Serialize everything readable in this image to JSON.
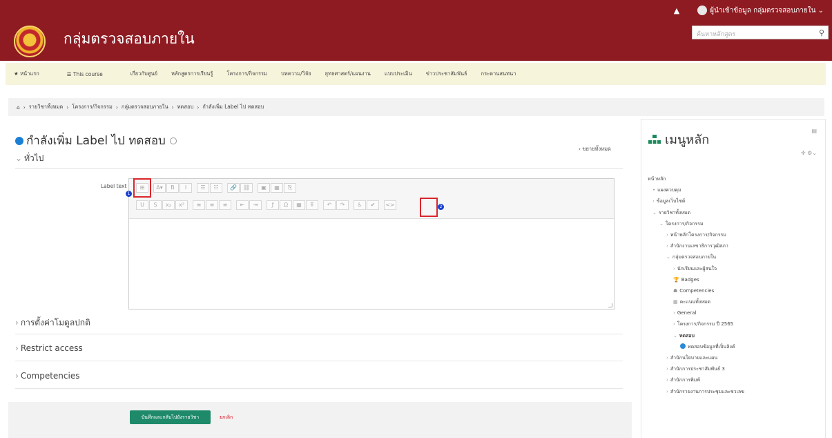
{
  "topbar": {
    "user_name": "ผู้นำเข้าข้อมูล กลุ่มตรวจสอบภายใน"
  },
  "header": {
    "site_name": "กลุ่มตรวจสอบภายใน",
    "search_placeholder": "ค้นหาหลักสูตร"
  },
  "nav": {
    "home": "หน้าแรก",
    "this_course": "This course",
    "items": [
      "เกี่ยวกับศูนย์",
      "หลักสูตรการเรียนรู้",
      "โครงการ/กิจกรรม",
      "บทความ/วิจัย",
      "ยุทธศาสตร์/แผนงาน",
      "แบบประเมิน",
      "ข่าวประชาสัมพันธ์",
      "กระดานสนทนา"
    ]
  },
  "breadcrumb": [
    "รายวิชาทั้งหมด",
    "โครงการ/กิจกรรม",
    "กลุ่มตรวจสอบภายใน",
    "ทดสอบ",
    "กำลังเพิ่ม Label ไป ทดสอบ"
  ],
  "page": {
    "title": "กำลังเพิ่ม Label ไป ทดสอบ",
    "expand_all": "ขยายทั้งหมด",
    "section_general": "ทั่วไป",
    "label_text": "Label text",
    "section_default": "การตั้งค่าโมดูลปกติ",
    "section_restrict": "Restrict access",
    "section_competencies": "Competencies",
    "save_button": "บันทึกและกลับไปยังรายวิชา",
    "cancel_button": "ยกเลิก",
    "markers": [
      "1",
      "2"
    ]
  },
  "editor_toolbar": {
    "row1": [
      "⊞",
      "A▾",
      "B",
      "I",
      "☰",
      "☷",
      "🔗",
      "⛓",
      "▣",
      "▦",
      "⎘"
    ],
    "row2": [
      "U",
      "S",
      "x₂",
      "x²",
      "≡",
      "≡",
      "≡",
      "⇤",
      "⇥",
      "ƒ",
      "Ω",
      "▦",
      "T̶",
      "↶",
      "↷",
      "♿",
      "✔",
      "<>"
    ]
  },
  "sidebar": {
    "title": "เมนูหลัก",
    "items": [
      {
        "label": "หน้าหลัก",
        "level": 0,
        "marker": ""
      },
      {
        "label": "แผงควบคุม",
        "level": 1,
        "marker": "•"
      },
      {
        "label": "ข้อมูลเว็บไซต์",
        "level": 1,
        "marker": "›"
      },
      {
        "label": "รายวิชาทั้งหมด",
        "level": 1,
        "marker": "⌄"
      },
      {
        "label": "โครงการ/กิจกรรม",
        "level": 2,
        "marker": "⌄"
      },
      {
        "label": "หน้าหลักโครงการ/กิจกรรม",
        "level": 3,
        "marker": "›"
      },
      {
        "label": "สำนักงานเลขาธิการวุฒิสภา",
        "level": 3,
        "marker": "›"
      },
      {
        "label": "กลุ่มตรวจสอบภายใน",
        "level": 3,
        "marker": "⌄"
      },
      {
        "label": "นักเรียนและผู้สนใจ",
        "level": 4,
        "marker": "›"
      },
      {
        "label": "Badges",
        "level": 4,
        "marker": "🏆"
      },
      {
        "label": "Competencies",
        "level": 4,
        "marker": "☗"
      },
      {
        "label": "คะแนนทั้งหมด",
        "level": 4,
        "marker": "▦"
      },
      {
        "label": "General",
        "level": 4,
        "marker": "›"
      },
      {
        "label": "โครงการ/กิจกรรม ปี 2565",
        "level": 4,
        "marker": "›"
      },
      {
        "label": "ทดสอบ",
        "level": 4,
        "marker": "⌄",
        "bold": true
      },
      {
        "label": "ทดสอบข้อมูลที่เป็นลิงค์",
        "level": 5,
        "marker": "dot"
      },
      {
        "label": "สำนักนโยบายและแผน",
        "level": 3,
        "marker": "›"
      },
      {
        "label": "สำนักการประชาสัมพันธ์ 3",
        "level": 3,
        "marker": "›"
      },
      {
        "label": "สำนักการพิมพ์",
        "level": 3,
        "marker": "›"
      },
      {
        "label": "สำนักรายงานการประชุมและชวเลข",
        "level": 3,
        "marker": "›"
      }
    ]
  }
}
